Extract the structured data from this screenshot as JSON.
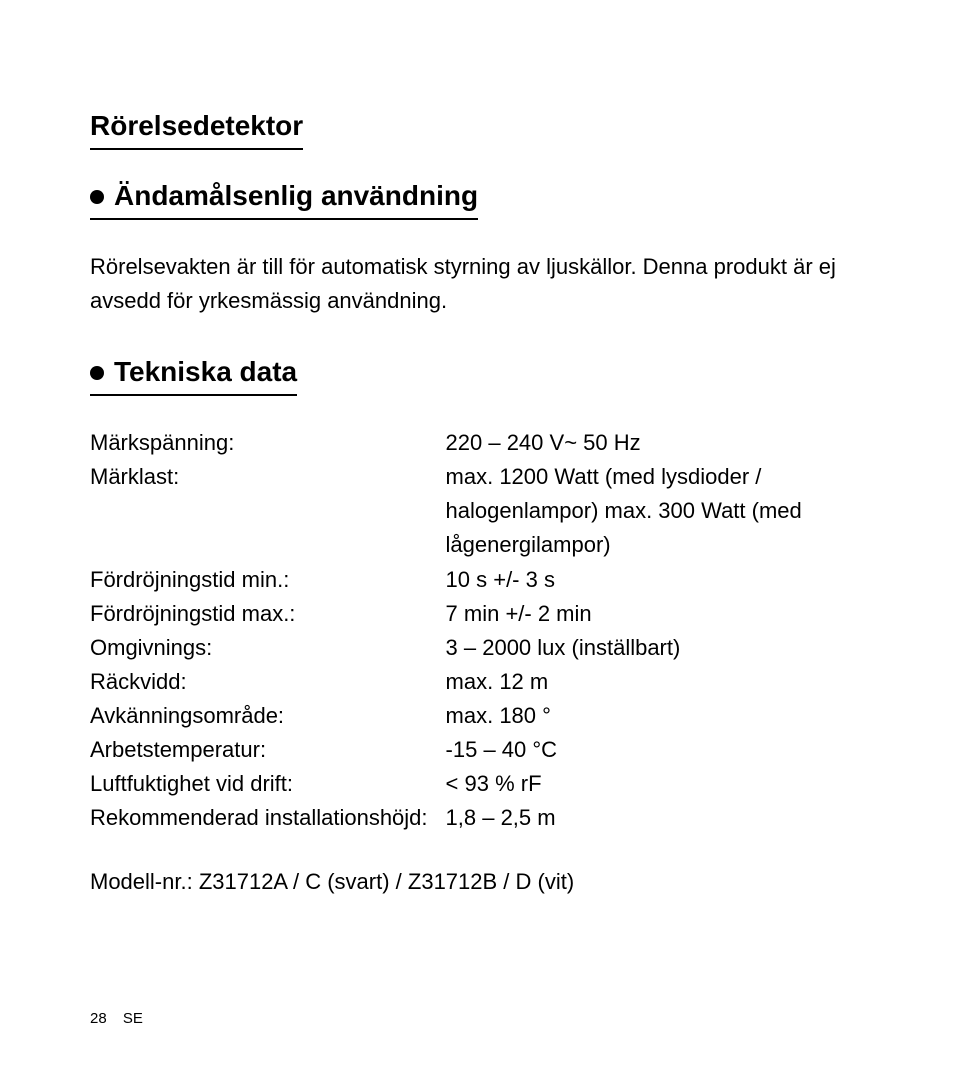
{
  "title": "Rörelsedetektor",
  "sections": {
    "intended_use": {
      "heading": "Ändamålsenlig användning",
      "body": "Rörelsevakten är till för automatisk styrning av ljuskällor. Denna produkt är ej avsedd för yrkesmässig användning."
    },
    "tech_data": {
      "heading": "Tekniska data",
      "rows": [
        {
          "label": "Märkspänning:",
          "value": "220 – 240 V~ 50 Hz"
        },
        {
          "label": "Märklast:",
          "value": "max. 1200 Watt (med lysdioder / halogenlampor) max. 300 Watt (med lågenergilampor)"
        },
        {
          "label": "Fördröjningstid min.:",
          "value": "10 s +/- 3 s"
        },
        {
          "label": "Fördröjningstid max.:",
          "value": "7 min +/- 2 min"
        },
        {
          "label": "Omgivnings:",
          "value": "3 – 2000 lux (inställbart)"
        },
        {
          "label": "Räckvidd:",
          "value": "max. 12 m"
        },
        {
          "label": "Avkänningsområde:",
          "value": "max. 180 °"
        },
        {
          "label": "Arbetstemperatur:",
          "value": "-15 – 40 °C"
        },
        {
          "label": "Luftfuktighet vid drift:",
          "value": "< 93 % rF"
        },
        {
          "label": "Rekommenderad installationshöjd:",
          "value": "1,8 – 2,5 m"
        }
      ],
      "model": "Modell-nr.: Z31712A / C (svart) / Z31712B / D (vit)"
    }
  },
  "footer": {
    "page_number": "28",
    "lang": "SE"
  }
}
